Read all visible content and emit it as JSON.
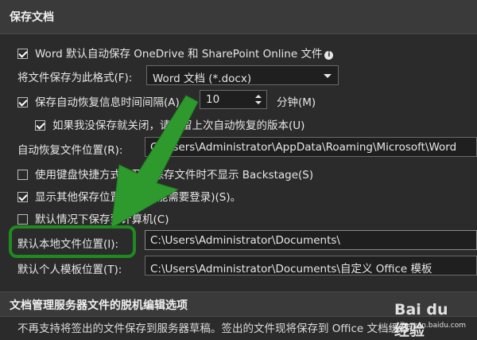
{
  "section_title": "保存文档",
  "autosave_checkbox": {
    "label": "Word 默认自动保存 OneDrive 和 SharePoint Online 文件",
    "checked": true
  },
  "save_format": {
    "label": "将文件保存为此格式(F):",
    "value": "Word 文档 (*.docx)"
  },
  "autorecover_interval": {
    "label": "保存自动恢复信息时间间隔(A)",
    "value": "10",
    "unit": "分钟(M)",
    "checked": true
  },
  "keep_last_version": {
    "label": "如果我没保存就关闭，请保留上次自动恢复的版本(U)",
    "checked": true
  },
  "autorecover_location": {
    "label": "自动恢复文件位置(R):",
    "value": "C:\\Users\\Administrator\\AppData\\Roaming\\Microsoft\\Word"
  },
  "no_backstage": {
    "label": "使用键盘快捷方式打开或保存文件时不显示 Backstage(S)",
    "checked": false
  },
  "show_other_locations": {
    "label": "显示其他保存位置(即使可能需要登录)(S)。",
    "checked": true
  },
  "save_to_computer": {
    "label": "默认情况下保存到计算机(C)",
    "checked": false
  },
  "default_local_location": {
    "label": "默认本地文件位置(I):",
    "value": "C:\\Users\\Administrator\\Documents\\"
  },
  "personal_templates_location": {
    "label": "默认个人模板位置(T):",
    "value": "C:\\Users\\Administrator\\Documents\\自定义 Office 模板"
  },
  "section2_title": "文档管理服务器文件的脱机编辑选项",
  "bottom_note": "不再支持将签出的文件保存到服务器草稿。签出的文件现将保存到 Office 文档缓存。",
  "watermark": {
    "logo": "Bai du 经验",
    "sub": "jingyan.baidu.com"
  },
  "colors": {
    "background": "#2b2b2b",
    "highlight": "#1f8a1f",
    "arrow": "#2e9a2e"
  }
}
